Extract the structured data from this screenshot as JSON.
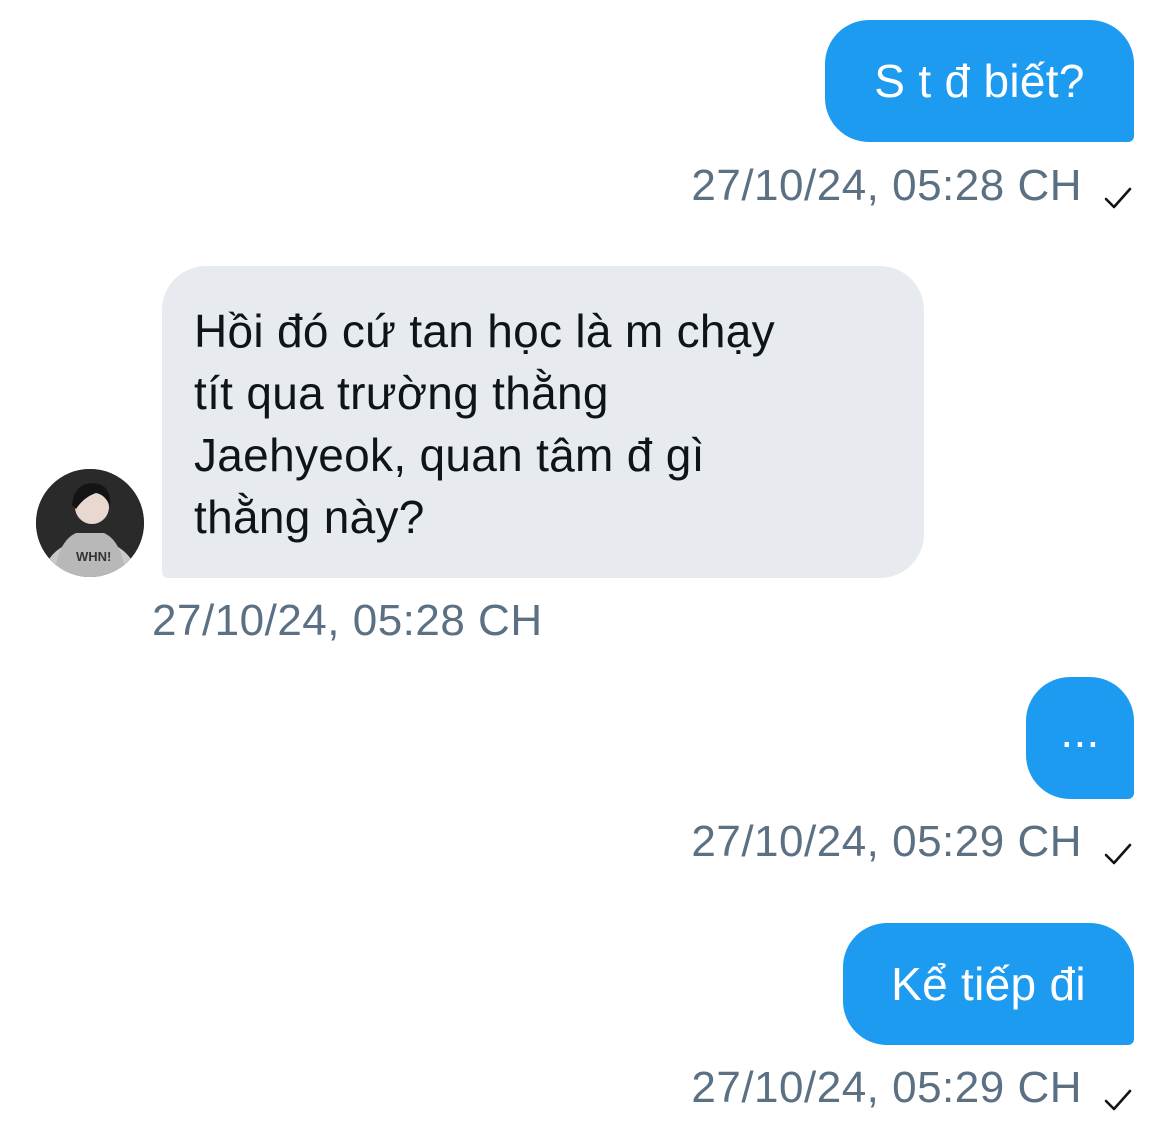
{
  "messages": [
    {
      "direction": "outgoing",
      "text": "S t đ biết?",
      "timestamp": "27/10/24, 05:28 CH",
      "status_icon": "check-icon"
    },
    {
      "direction": "incoming",
      "lines": [
        "Hồi đó cứ tan học là m chạy",
        "tít qua trường thằng",
        "Jaehyeok, quan tâm đ gì",
        "thằng này?"
      ],
      "timestamp": "27/10/24, 05:28 CH",
      "avatar_icon": "user-avatar-icon"
    },
    {
      "direction": "outgoing",
      "text": "...",
      "timestamp": "27/10/24, 05:29 CH",
      "status_icon": "check-icon"
    },
    {
      "direction": "outgoing",
      "text": "Kể tiếp đi",
      "timestamp": "27/10/24, 05:29 CH",
      "status_icon": "check-icon"
    }
  ],
  "colors": {
    "outgoing_bubble": "#1d9bf0",
    "incoming_bubble": "#e7ebef",
    "timestamp_text": "#5b7083",
    "background": "#ffffff"
  }
}
